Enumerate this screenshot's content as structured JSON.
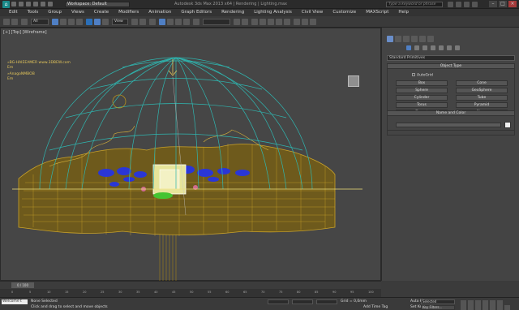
{
  "titlebar": {
    "workspace_label": "Workspace: Default",
    "title": "Autodesk 3ds Max 2013 x64 | Rendering | Lighting.max",
    "search_placeholder": "Type a keyword or phrase"
  },
  "menu": [
    "Edit",
    "Tools",
    "Group",
    "Views",
    "Create",
    "Modifiers",
    "Animation",
    "Graph Editors",
    "Rendering",
    "Lighting Analysis",
    "Civil View",
    "Customize",
    "MAXScript",
    "Help"
  ],
  "toolbar": {
    "filter_value": "All",
    "refcoord_value": "View"
  },
  "viewport": {
    "label": "[+] [Top] [Wireframe]",
    "annotation1": "»BG-HAIEEAMER www.3DBEW.com",
    "annotation1_sub": "Еm",
    "annotation2": "»AnagoNMBOB",
    "annotation2_sub": "Еm"
  },
  "command_panel": {
    "dropdown_value": "Standard Primitives",
    "object_type_header": "Object Type",
    "autogrid_label": "AutoGrid",
    "buttons": [
      "Box",
      "Cone",
      "Sphere",
      "GeoSphere",
      "Cylinder",
      "Tube",
      "Torus",
      "Pyramid",
      "Teapot",
      "Plane"
    ],
    "name_color_header": "Name and Color"
  },
  "timeline": {
    "slider_label": "0 / 100",
    "ruler_ticks": [
      "0",
      "5",
      "10",
      "15",
      "20",
      "25",
      "30",
      "35",
      "40",
      "45",
      "50",
      "55",
      "60",
      "65",
      "70",
      "75",
      "80",
      "85",
      "90",
      "95",
      "100"
    ]
  },
  "status": {
    "maxscript_label": "Welcome t",
    "line1": "None Selected",
    "line2": "Click and drag to select and move objects",
    "grid": "Grid = 0,0mm",
    "add_time_tag": "Add Time Tag",
    "auto_key": "Auto Key",
    "set_key": "Set Key",
    "selected_value": "Selected",
    "key_filters": "Key Filters..."
  },
  "colors": {
    "dome": "#2fb6b0",
    "trees": "#b5911e",
    "flowers": "#2a36d6",
    "accent": "#e3c55a"
  }
}
